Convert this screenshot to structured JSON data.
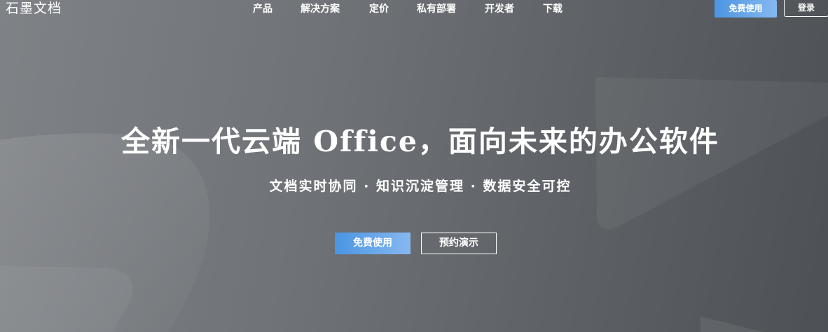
{
  "brand": {
    "logo_text": "石墨文档"
  },
  "nav": {
    "items": [
      {
        "label": "产品"
      },
      {
        "label": "解决方案"
      },
      {
        "label": "定价"
      },
      {
        "label": "私有部署"
      },
      {
        "label": "开发者"
      },
      {
        "label": "下载"
      }
    ],
    "free_button": "免费使用",
    "login_button": "登录"
  },
  "hero": {
    "title": "全新一代云端 Office，面向未来的办公软件",
    "subtitle": "文档实时协同 · 知识沉淀管理 · 数据安全可控",
    "primary_cta": "免费使用",
    "secondary_cta": "预约演示"
  },
  "colors": {
    "accent_start": "#4b95e3",
    "accent_end": "#86b8f0",
    "background": "#6f7377"
  }
}
